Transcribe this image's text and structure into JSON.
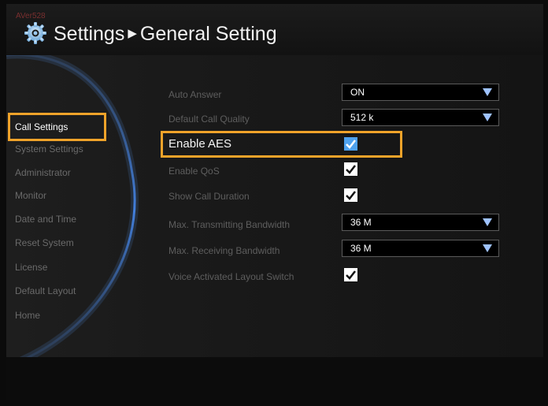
{
  "header": {
    "brand": "AVer528",
    "title_section": "Settings",
    "title_arrow": "▶",
    "title_page": "General Setting",
    "icon": "gear-icon"
  },
  "sidebar": {
    "items": [
      {
        "label": "Call Settings",
        "active": true
      },
      {
        "label": "System Settings",
        "active": false
      },
      {
        "label": "Administrator",
        "active": false
      },
      {
        "label": "Monitor",
        "active": false
      },
      {
        "label": "Date and Time",
        "active": false
      },
      {
        "label": "Reset System",
        "active": false
      },
      {
        "label": "License",
        "active": false
      },
      {
        "label": "Default Layout",
        "active": false
      },
      {
        "label": "Home",
        "active": false
      }
    ]
  },
  "settings": {
    "rows": [
      {
        "label": "Auto Answer",
        "type": "dropdown",
        "value": "ON"
      },
      {
        "label": "Default Call Quality",
        "type": "dropdown",
        "value": "512 k"
      },
      {
        "label": "Enable AES",
        "type": "checkbox",
        "checked": true,
        "focused": true
      },
      {
        "label": "Enable QoS",
        "type": "checkbox",
        "checked": true
      },
      {
        "label": "Show Call Duration",
        "type": "checkbox",
        "checked": true
      },
      {
        "label": "Max. Transmitting Bandwidth",
        "type": "dropdown",
        "value": "36 M"
      },
      {
        "label": "Max. Receiving Bandwidth",
        "type": "dropdown",
        "value": "36 M"
      },
      {
        "label": "Voice Activated Layout Switch",
        "type": "checkbox",
        "checked": true
      }
    ]
  },
  "colors": {
    "highlight": "#f0a32a",
    "focused_checkbox": "#4fa2ee",
    "dropdown_arrow": "#9fc3ff"
  }
}
